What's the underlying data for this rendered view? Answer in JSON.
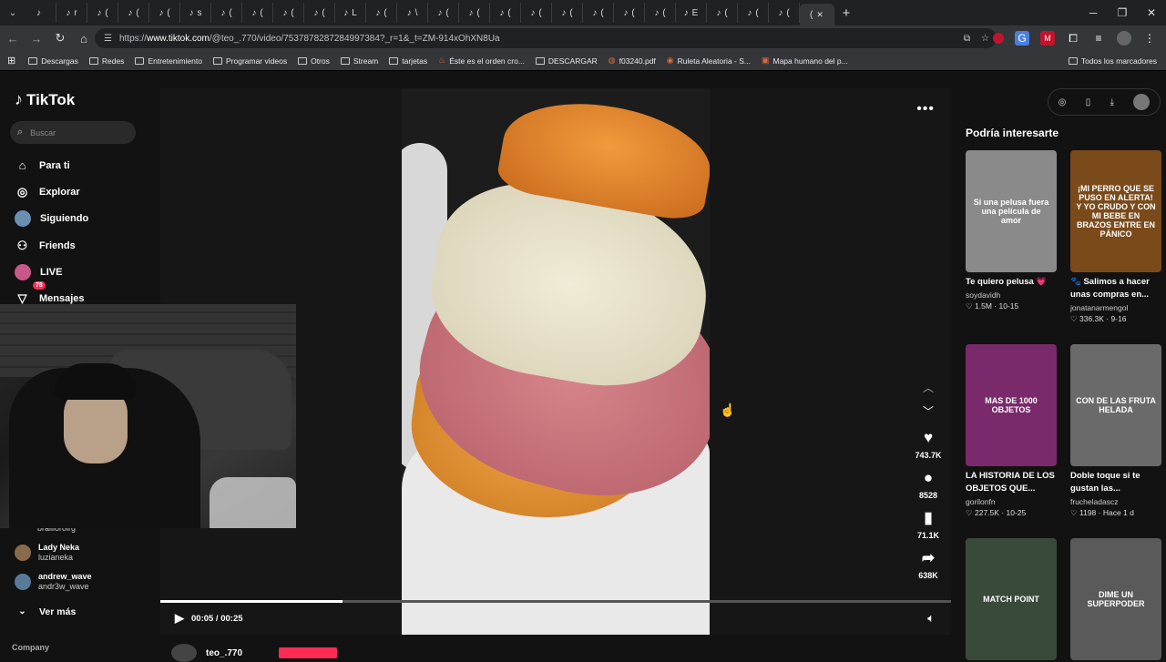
{
  "browser": {
    "tab_glyph": "♪ (",
    "tab_letters": [
      "",
      "r",
      "(",
      "(",
      "(",
      "s",
      "(",
      "(",
      "(",
      "(",
      "L",
      "(",
      "\\",
      "(",
      "(",
      "(",
      "(",
      "(",
      "(",
      "(",
      "(",
      "E",
      "(",
      "(",
      "("
    ],
    "active_tab": "(",
    "url_prefix": "https://",
    "url_domain": "www.tiktok.com",
    "url_path": "/@teo_.770/video/7537878287284997384?_r=1&_t=ZM-914xOhXN8Ua",
    "bookmarks": [
      {
        "label": "Descargas",
        "icon": "folder-icon"
      },
      {
        "label": "Redes",
        "icon": "folder-icon"
      },
      {
        "label": "Entretenimiento",
        "icon": "folder-icon"
      },
      {
        "label": "Programar videos",
        "icon": "folder-icon"
      },
      {
        "label": "Otros",
        "icon": "folder-icon"
      },
      {
        "label": "Stream",
        "icon": "folder-icon"
      },
      {
        "label": "tarjetas",
        "icon": "folder-icon"
      },
      {
        "label": "Éste es el orden cro...",
        "icon": "bottle-icon"
      },
      {
        "label": "DESCARGAR",
        "icon": "folder-icon"
      },
      {
        "label": "f03240.pdf",
        "icon": "globe-icon"
      },
      {
        "label": "Ruleta Aleatoria - S...",
        "icon": "wheel-icon"
      },
      {
        "label": "Mapa humano del p...",
        "icon": "map-icon"
      }
    ],
    "all_bookmarks": "Todos los marcadores"
  },
  "sidebar": {
    "logo": "TikTok",
    "search_placeholder": "Buscar",
    "nav": [
      {
        "label": "Para ti",
        "icon": "home-icon"
      },
      {
        "label": "Explorar",
        "icon": "compass-icon"
      },
      {
        "label": "Siguiendo",
        "icon": "avatar"
      },
      {
        "label": "Friends",
        "icon": "friends-icon"
      },
      {
        "label": "LIVE",
        "icon": "live-icon"
      },
      {
        "label": "Mensajes",
        "icon": "messages-icon",
        "badge": "78"
      }
    ],
    "partial_handle": "brailloroirg",
    "following": [
      {
        "name": "Lady Neka",
        "handle": "luzianeka"
      },
      {
        "name": "andrew_wave",
        "handle": "andr3w_wave"
      }
    ],
    "see_more": "Ver más",
    "company": "Company"
  },
  "player": {
    "time": "00:05 / 00:25",
    "progress": 0.23,
    "likes": "743.7K",
    "comments": "8528",
    "saves": "71.1K",
    "shares": "638K",
    "author": "teo_.770"
  },
  "recommendations": {
    "title": "Podría interesarte",
    "cards": [
      {
        "caption": "Te quiero pelusa 💗",
        "author": "soydavidh",
        "likes": "1.5M",
        "date": "10-15",
        "thumb_text": "Si una pelusa fuera una película de amor",
        "thumb_color": "#8a8a8a"
      },
      {
        "caption": "🐾 Salimos a hacer unas compras en...",
        "author": "jonatanarmengol",
        "likes": "336.3K",
        "date": "9-16",
        "thumb_text": "¡MI PERRO QUE SE PUSO EN ALERTA! Y YO CRUDO Y CON MI BEBE EN BRAZOS ENTRE EN PÁNICO",
        "thumb_color": "#7a4a1a"
      },
      {
        "caption": "LA HISTORIA DE LOS OBJETOS QUE...",
        "author": "gorilonfn",
        "likes": "227.5K",
        "date": "10-25",
        "thumb_text": "MAS DE 1000 OBJETOS",
        "thumb_color": "#7a2a6a"
      },
      {
        "caption": "Doble toque si te gustan las...",
        "author": "frucheladascz",
        "likes": "1198",
        "date": "Hace 1 d",
        "thumb_text": "CON DE LAS FRUTA HELADA",
        "thumb_color": "#6a6a6a"
      },
      {
        "caption": "",
        "author": "",
        "likes": "",
        "date": "",
        "thumb_text": "MATCH POINT",
        "thumb_color": "#3a4a3a"
      },
      {
        "caption": "",
        "author": "",
        "likes": "",
        "date": "",
        "thumb_text": "DIME UN SUPERPODER",
        "thumb_color": "#5a5a5a"
      }
    ]
  }
}
